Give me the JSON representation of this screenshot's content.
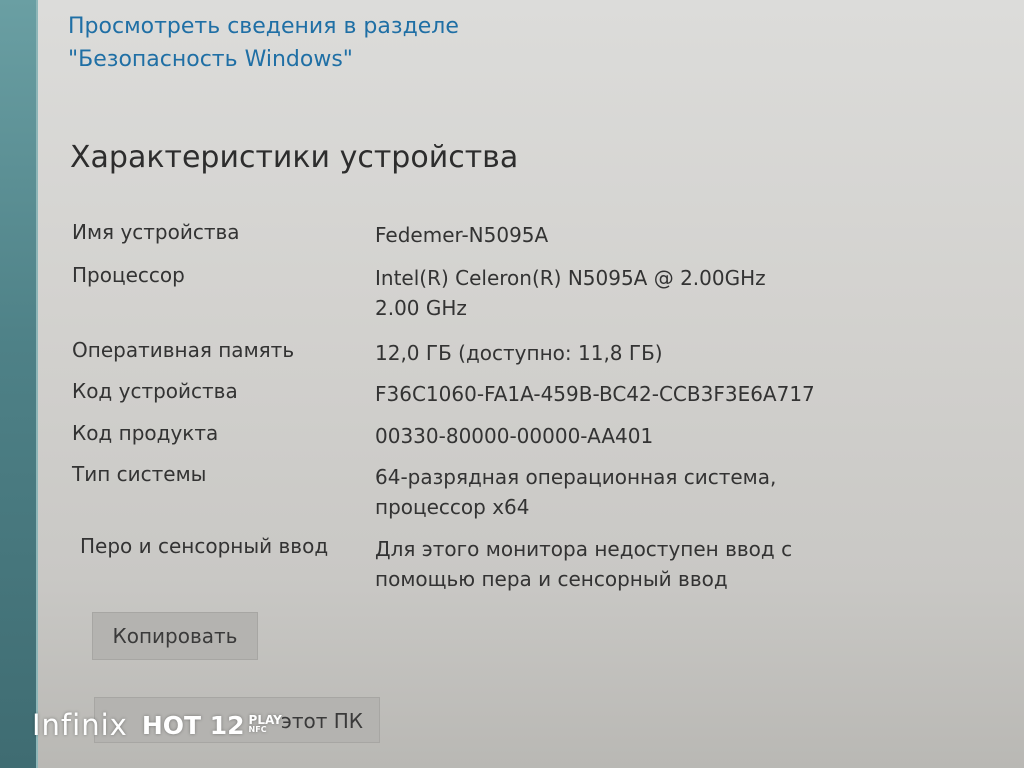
{
  "security_link": "Просмотреть сведения в разделе \"Безопасность Windows\"",
  "device_specs": {
    "title": "Характеристики устройства",
    "rows": [
      {
        "label": "Имя устройства",
        "value": "Fedemer-N5095A"
      },
      {
        "label": "Процессор",
        "value": "Intel(R) Celeron(R) N5095A @ 2.00GHz 2.00 GHz"
      },
      {
        "label": "Оперативная память",
        "value": "12,0 ГБ (доступно: 11,8 ГБ)"
      },
      {
        "label": "Код устройства",
        "value": "F36C1060-FA1A-459B-BC42-CCB3F3E6A717"
      },
      {
        "label": "Код продукта",
        "value": "00330-80000-00000-AA401"
      },
      {
        "label": "Тип системы",
        "value": "64-разрядная операционная система, процессор x64"
      },
      {
        "label": "Перо и сенсорный ввод",
        "value": "Для этого монитора недоступен ввод с помощью пера и сенсорный ввод"
      }
    ]
  },
  "buttons": {
    "copy": "Копировать",
    "rename_visible": "этот ПК"
  },
  "watermark": {
    "brand": "Infinix",
    "model": "HOT 12",
    "play": "PLAY",
    "nfc": "NFC"
  },
  "colors": {
    "link": "#1f6fa5",
    "button_bg": "#b4b3b0",
    "sidebar_strip": "#4e8187"
  }
}
